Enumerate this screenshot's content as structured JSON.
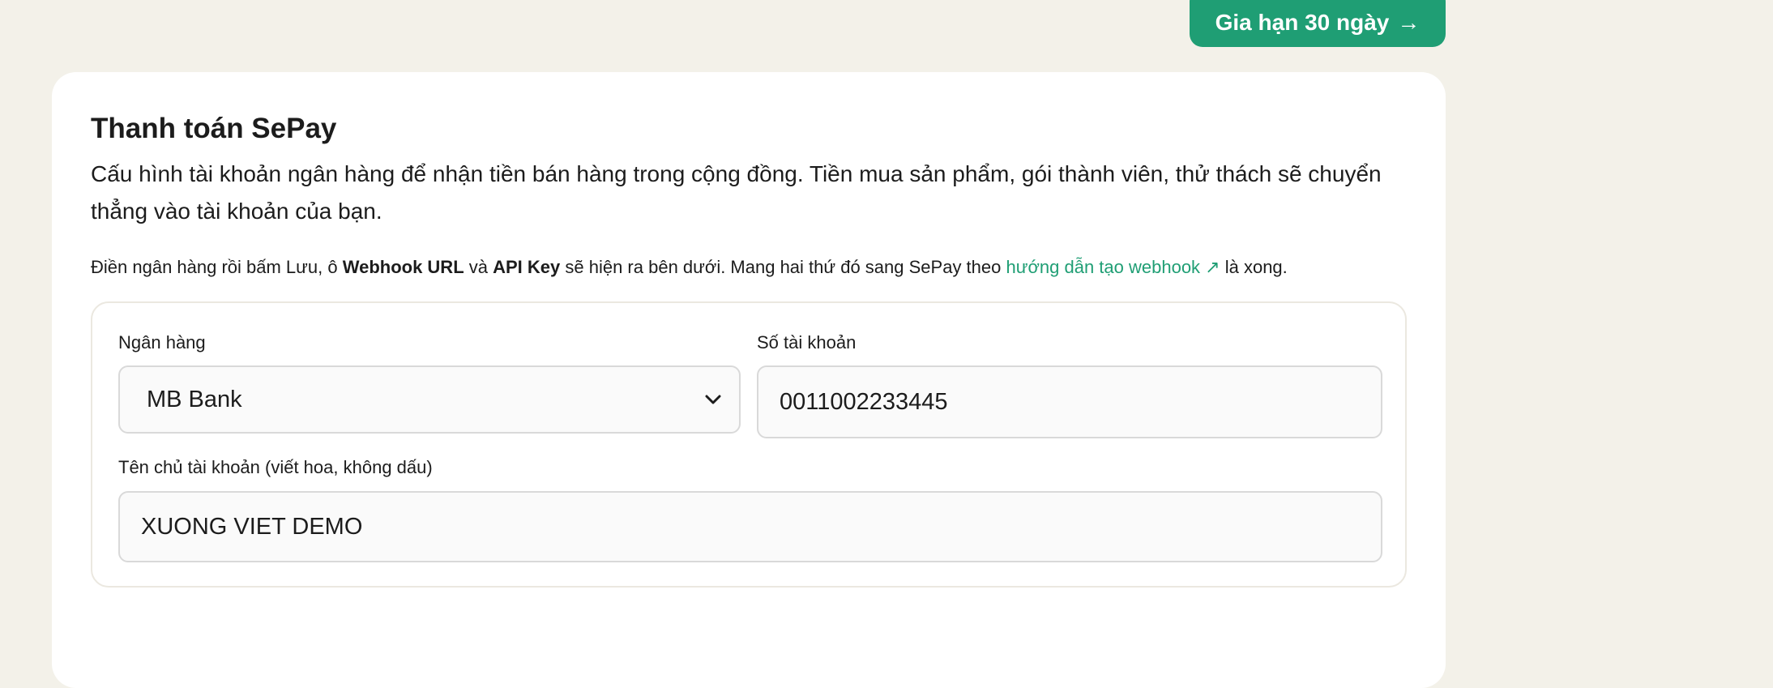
{
  "header": {
    "renew_button_label": "Gia hạn 30 ngày",
    "renew_button_arrow": "→"
  },
  "card": {
    "title": "Thanh toán SePay",
    "description": "Cấu hình tài khoản ngân hàng để nhận tiền bán hàng trong cộng đồng. Tiền mua sản phẩm, gói thành viên, thử thách sẽ chuyển thẳng vào tài khoản của bạn.",
    "hint": {
      "part1": "Điền ngân hàng rồi bấm Lưu, ô ",
      "webhook_url_bold": "Webhook URL",
      "part2": " và ",
      "api_key_bold": "API Key",
      "part3": " sẽ hiện ra bên dưới. Mang hai thứ đó sang SePay theo ",
      "guide_link": "hướng dẫn tạo webhook ↗",
      "part4": " là xong."
    }
  },
  "form": {
    "bank": {
      "label": "Ngân hàng",
      "selected_value": "MB Bank"
    },
    "account_number": {
      "label": "Số tài khoản",
      "value": "0011002233445"
    },
    "account_holder": {
      "label": "Tên chủ tài khoản (viết hoa, không dấu)",
      "value": "XUONG VIET DEMO"
    }
  },
  "colors": {
    "page_background": "#f3f1e9",
    "accent": "#1f9e74",
    "card_background": "#ffffff",
    "input_background": "#fafafa",
    "input_border": "#d9d9d9"
  },
  "icons": {
    "renew_arrow": "arrow-right-icon",
    "guide_link": "external-link-icon",
    "bank_select": "chevron-down-icon"
  }
}
